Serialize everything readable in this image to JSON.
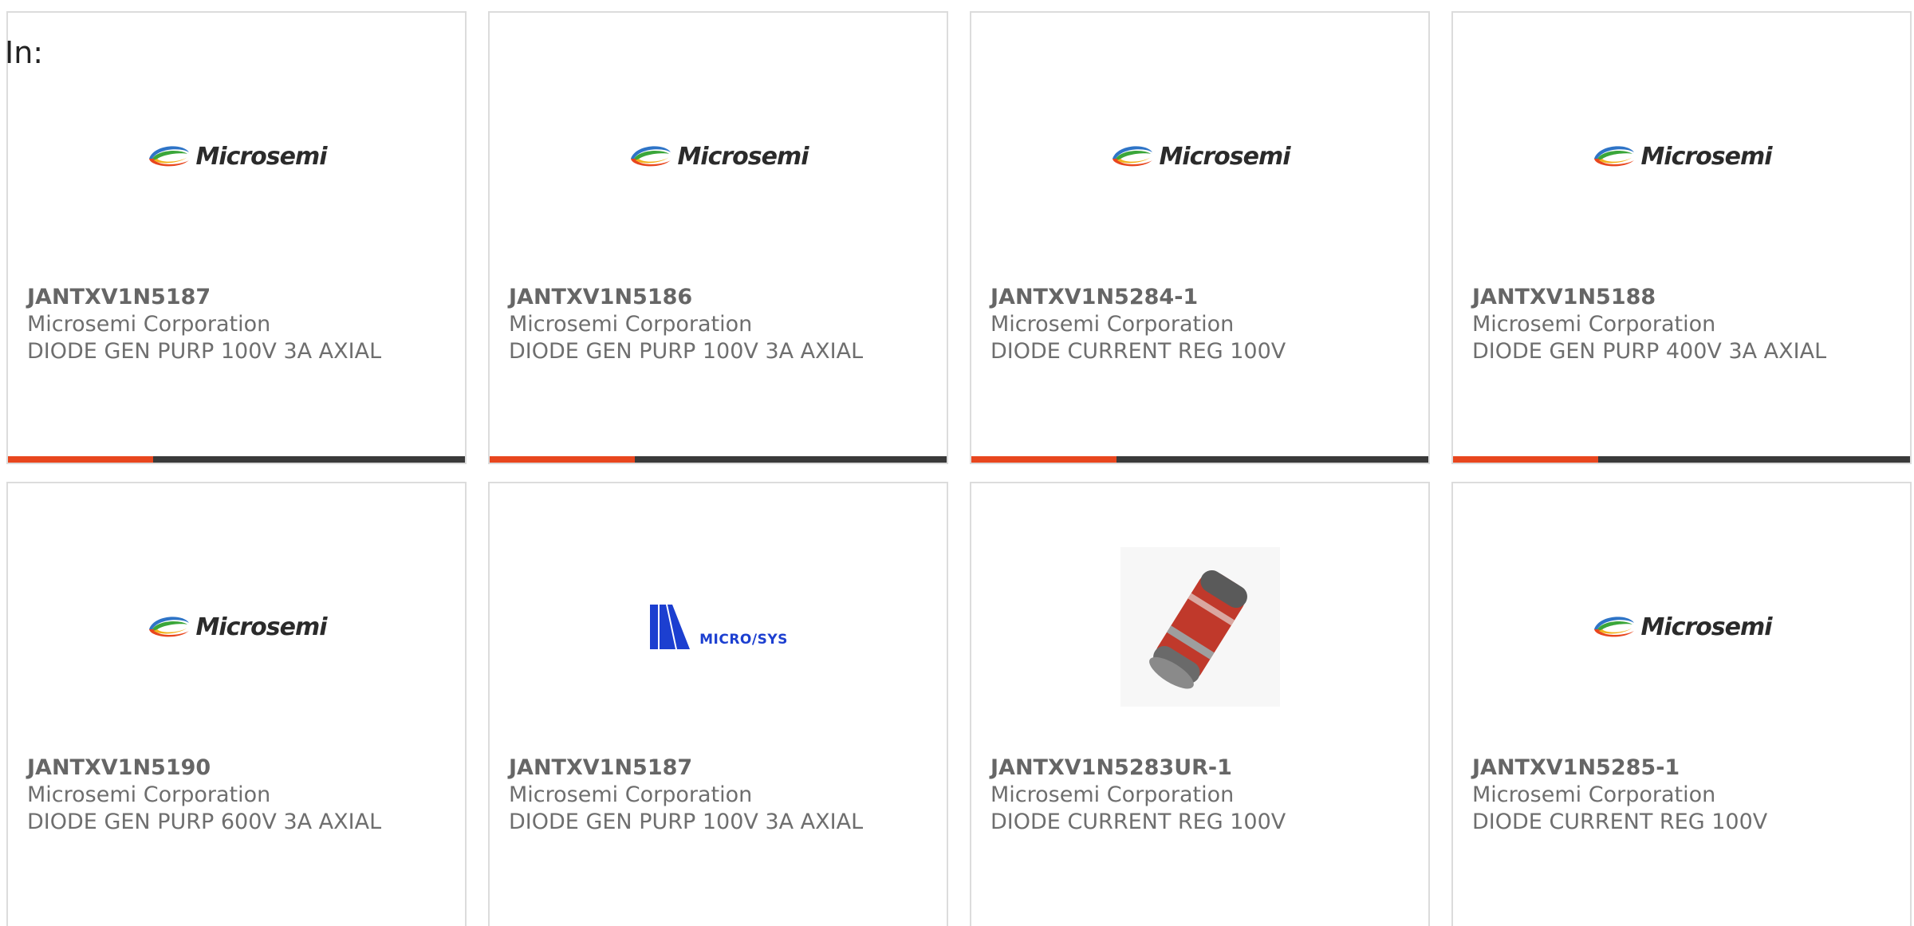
{
  "filter": {
    "label": "In:"
  },
  "colors": {
    "accent_bar": "#e8461e",
    "bar": "#3a3a3a",
    "card_border": "#dcdcdc",
    "microsys_blue": "#1c3fd0"
  },
  "products": [
    {
      "part_number": "JANTXV1N5187",
      "manufacturer": "Microsemi Corporation",
      "description": "DIODE GEN PURP 100V 3A AXIAL",
      "image": "microsemi-logo",
      "logo_text": "Microsemi"
    },
    {
      "part_number": "JANTXV1N5186",
      "manufacturer": "Microsemi Corporation",
      "description": "DIODE GEN PURP 100V 3A AXIAL",
      "image": "microsemi-logo",
      "logo_text": "Microsemi"
    },
    {
      "part_number": "JANTXV1N5284-1",
      "manufacturer": "Microsemi Corporation",
      "description": "DIODE CURRENT REG 100V",
      "image": "microsemi-logo",
      "logo_text": "Microsemi"
    },
    {
      "part_number": "JANTXV1N5188",
      "manufacturer": "Microsemi Corporation",
      "description": "DIODE GEN PURP 400V 3A AXIAL",
      "image": "microsemi-logo",
      "logo_text": "Microsemi"
    },
    {
      "part_number": "JANTXV1N5190",
      "manufacturer": "Microsemi Corporation",
      "description": "DIODE GEN PURP 600V 3A AXIAL",
      "image": "microsemi-logo",
      "logo_text": "Microsemi"
    },
    {
      "part_number": "JANTXV1N5187",
      "manufacturer": "Microsemi Corporation",
      "description": "DIODE GEN PURP 100V 3A AXIAL",
      "image": "microsys-logo",
      "logo_text": "MICRO/SYS"
    },
    {
      "part_number": "JANTXV1N5283UR-1",
      "manufacturer": "Microsemi Corporation",
      "description": "DIODE CURRENT REG 100V",
      "image": "diode-photo",
      "logo_text": ""
    },
    {
      "part_number": "JANTXV1N5285-1",
      "manufacturer": "Microsemi Corporation",
      "description": "DIODE CURRENT REG 100V",
      "image": "microsemi-logo",
      "logo_text": "Microsemi"
    }
  ]
}
